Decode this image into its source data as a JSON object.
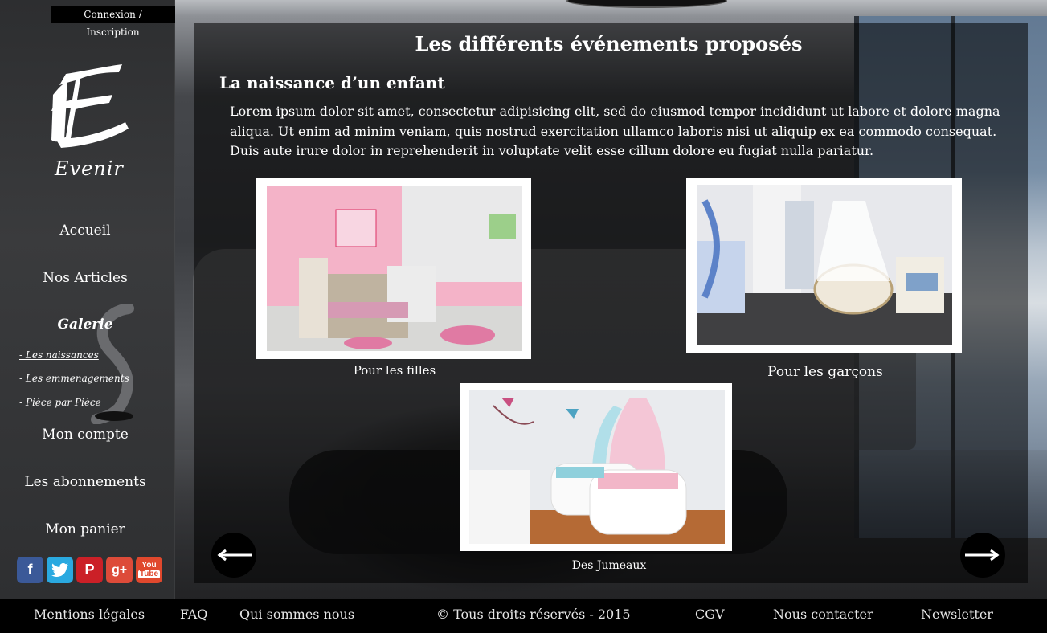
{
  "top": {
    "login_label": "Connexion / Inscription"
  },
  "brand": {
    "name": "Evenir"
  },
  "sidebar": {
    "nav": [
      {
        "label": "Accueil"
      },
      {
        "label": "Nos Articles"
      },
      {
        "label": "Galerie"
      },
      {
        "label": "Mon compte"
      },
      {
        "label": "Les abonnements"
      },
      {
        "label": "Mon panier"
      }
    ],
    "gallery_sub": [
      {
        "label": "- Les naissances"
      },
      {
        "label": "- Les emmenagements"
      },
      {
        "label": "- Pièce par Pièce"
      }
    ],
    "social": [
      {
        "icon": "facebook-icon",
        "glyph": "f",
        "color": "#3b5998"
      },
      {
        "icon": "twitter-icon",
        "glyph": "t",
        "color": "#2aa9e0"
      },
      {
        "icon": "pinterest-icon",
        "glyph": "P",
        "color": "#cb2027"
      },
      {
        "icon": "google-plus-icon",
        "glyph": "g+",
        "color": "#dd4b39"
      },
      {
        "icon": "youtube-icon",
        "glyph": "You",
        "color": "#e0482d"
      }
    ]
  },
  "main": {
    "title": "Les différents événements proposés",
    "section_title": "La naissance d’un enfant",
    "intro": "Lorem ipsum dolor sit amet, consectetur adipisicing elit, sed do eiusmod tempor incididunt ut labore et dolore magna aliqua. Ut enim ad minim veniam, quis nostrud exercitation ullamco laboris nisi ut aliquip ex ea commodo consequat. Duis aute irure dolor in reprehenderit in voluptate velit esse cillum dolore eu fugiat nulla pariatur.",
    "cards": [
      {
        "caption": "Pour les filles"
      },
      {
        "caption": "Pour les garçons"
      },
      {
        "caption": "Des Jumeaux"
      }
    ]
  },
  "footer": {
    "links": [
      {
        "label": "Mentions légales"
      },
      {
        "label": "FAQ"
      },
      {
        "label": "Qui sommes nous"
      },
      {
        "label": "© Tous droits réservés - 2015"
      },
      {
        "label": "CGV"
      },
      {
        "label": "Nous contacter"
      },
      {
        "label": "Newsletter"
      }
    ]
  }
}
